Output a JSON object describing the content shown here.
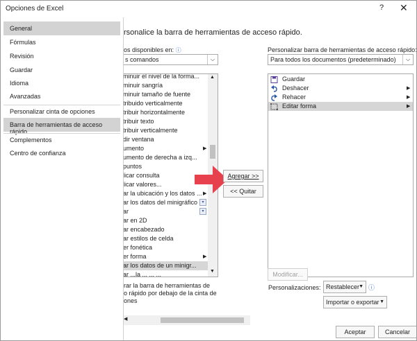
{
  "window": {
    "title": "Opciones de Excel",
    "help_glyph": "?",
    "close_glyph": "✕"
  },
  "sidebar": {
    "items": [
      {
        "label": "General"
      },
      {
        "label": "Fórmulas"
      },
      {
        "label": "Revisión"
      },
      {
        "label": "Guardar"
      },
      {
        "label": "Idioma"
      },
      {
        "label": "Avanzadas"
      },
      {
        "label": "Personalizar cinta de opciones"
      },
      {
        "label": "Barra de herramientas de acceso rápido"
      },
      {
        "label": "Complementos"
      },
      {
        "label": "Centro de confianza"
      }
    ]
  },
  "main": {
    "heading": "rsonalice la barra de herramientas de acceso rápido.",
    "commands_label": "os disponibles en:",
    "commands_value": "s comandos",
    "commands_list": [
      "minuir el nivel de la forma...",
      "minuir sangría",
      "minuir tamaño de fuente",
      "tribuido verticalmente",
      "tribuir horizontalmente",
      "tribuir texto",
      "tribuir verticalmente",
      "dir ventana",
      "umento",
      "umento de derecha a izq...",
      "puntos",
      "licar consulta",
      "licar valores...",
      "ar la ubicación y los datos ...",
      "ar los datos del minigráfico",
      "ar",
      "ar en 2D",
      "ar encabezado",
      "ar estilos de celda",
      "er fonética",
      "er forma",
      "ar los datos de un minigr...",
      "ar ...la ... ... ..."
    ],
    "below_checkbox_text_1": "rar la barra de herramientas de",
    "below_checkbox_text_2": "o rápido por debajo de la cinta de",
    "below_checkbox_text_3": "ones",
    "add_button": "Agregar >>",
    "remove_button": "<< Quitar",
    "qat_label": "Personalizar barra de herramientas de acceso rápido:",
    "qat_value": "Para todos los documentos (predeterminado)",
    "qat_list": [
      {
        "label": "Guardar",
        "icon": "save-icon"
      },
      {
        "label": "Deshacer",
        "icon": "undo-icon"
      },
      {
        "label": "Rehacer",
        "icon": "redo-icon"
      },
      {
        "label": "Editar forma",
        "icon": "edit-shape-icon"
      }
    ],
    "modify_button": "Modificar...",
    "customizations_label": "Personalizaciones:",
    "reset_button": "Restablecer",
    "import_export_button": "Importar o exportar",
    "ok_button": "Aceptar",
    "cancel_button": "Cancelar"
  },
  "colors": {
    "arrow": "#e8414e",
    "selection": "#d3d3d3"
  }
}
